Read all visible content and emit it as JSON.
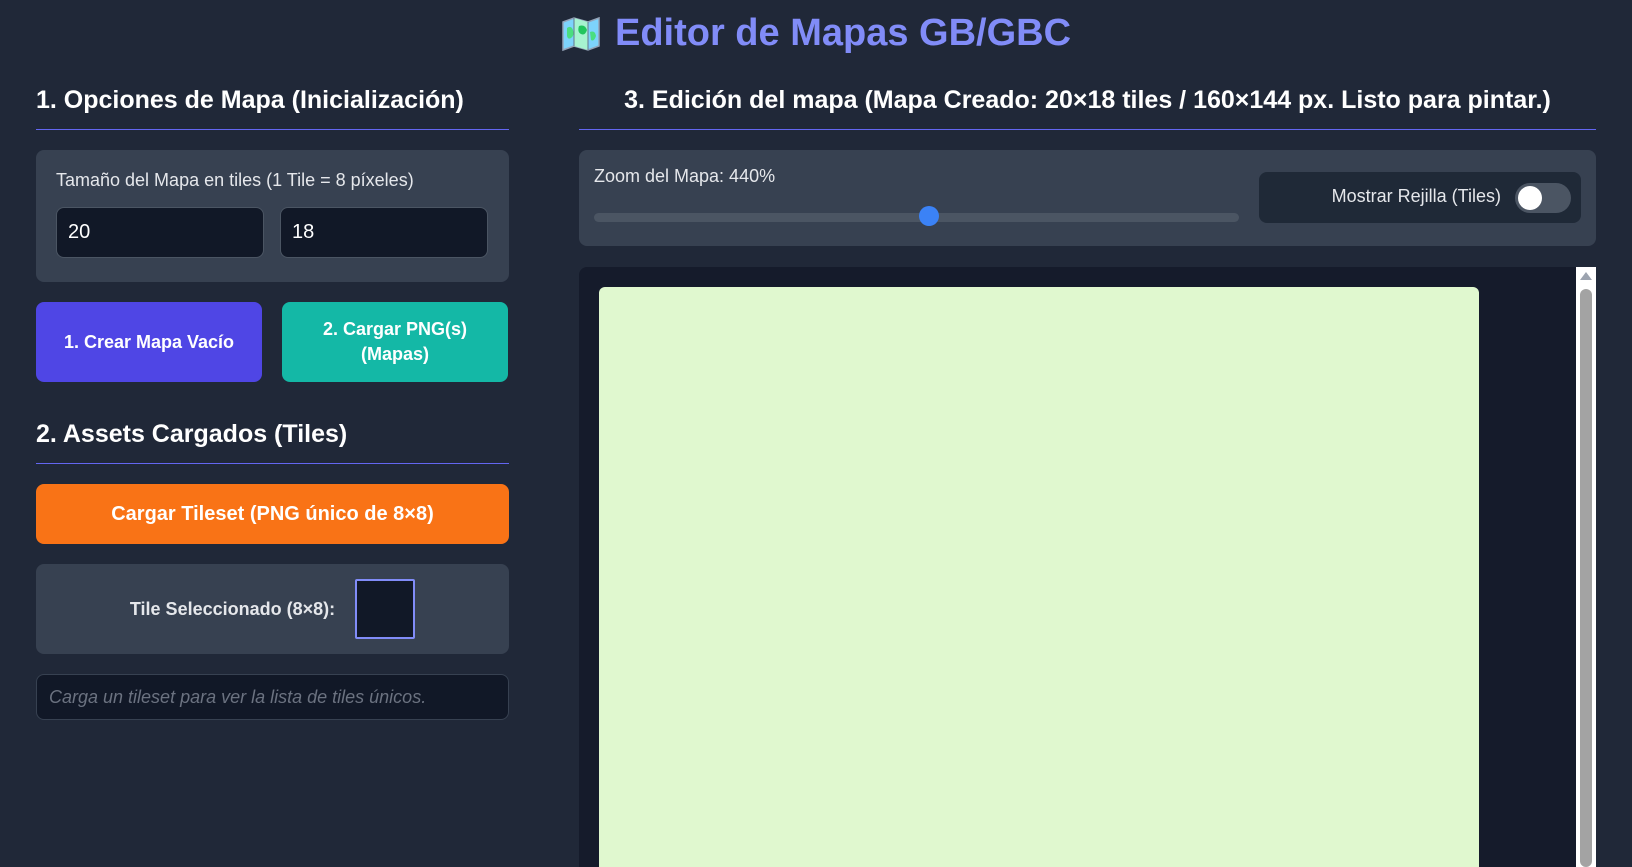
{
  "header": {
    "title": "Editor de Mapas GB/GBC",
    "icon": "map-icon"
  },
  "map_options": {
    "title": "1. Opciones de Mapa (Inicialización)",
    "size_label": "Tamaño del Mapa en tiles (1 Tile = 8 píxeles)",
    "width_value": "20",
    "height_value": "18",
    "create_button": "1. Crear Mapa Vacío",
    "load_png_button": "2. Cargar PNG(s) (Mapas)"
  },
  "assets": {
    "title": "2. Assets Cargados (Tiles)",
    "load_tileset_button": "Cargar Tileset (PNG único de 8×8)",
    "selected_tile_label": "Tile Seleccionado (8×8):",
    "tile_list_hint": "Carga un tileset para ver la lista de tiles únicos."
  },
  "edit": {
    "title": "3. Edición del mapa (Mapa Creado: 20×18 tiles / 160×144 px. Listo para pintar.)",
    "zoom_label": "Zoom del Mapa: 440%",
    "zoom_fraction": 0.52,
    "grid_label": "Mostrar Rejilla (Tiles)",
    "grid_on": false,
    "map_background_color": "#e0f8cf"
  },
  "colors": {
    "accent": "#818cf8",
    "create_button": "#4f46e5",
    "load_button": "#14b8a6",
    "tileset_button": "#f97316"
  }
}
